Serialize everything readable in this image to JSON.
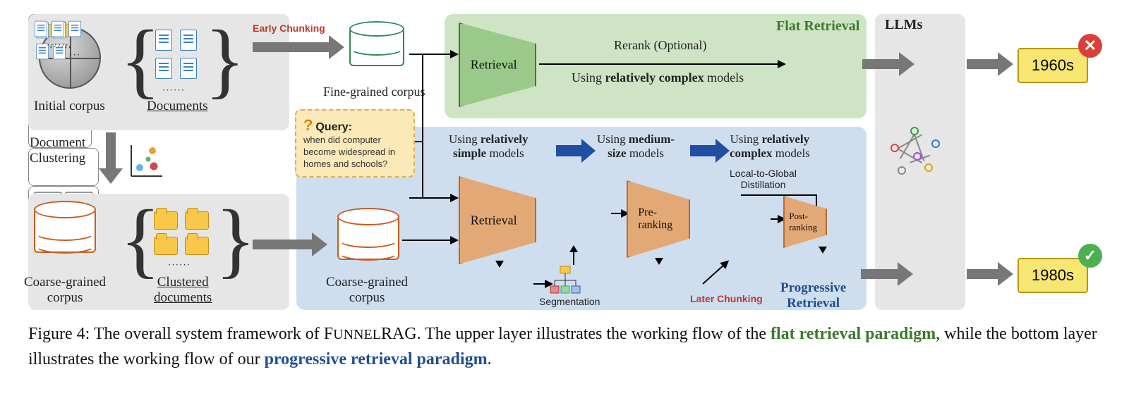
{
  "labels": {
    "initial_corpus": "Initial corpus",
    "documents": "Documents",
    "document_clustering": "Document\nClustering",
    "coarse_corpus_left": "Coarse-grained\ncorpus",
    "clustered_documents": "Clustered\ndocuments",
    "early_chunking": "Early Chunking",
    "fine_corpus": "Fine-grained corpus",
    "coarse_corpus_right": "Coarse-grained\ncorpus",
    "query_label": "Query:",
    "query_text": "when did computer become widespread in homes and schools?",
    "retrieval": "Retrieval",
    "pre_ranking": "Pre-\nranking",
    "post_ranking": "Post-\nranking",
    "rerank": "Rerank (Optional)",
    "using_complex": "Using relatively complex models",
    "using_simple": "Using relatively\nsimple models",
    "using_medium": "Using medium-\nsize models",
    "using_complex2": "Using relatively\ncomplex models",
    "local_to_global": "Local-to-Global\nDistillation",
    "flat_retrieval": "Flat Retrieval",
    "progressive_retrieval": "Progressive\nRetrieval",
    "segmentation": "Segmentation",
    "later_chunking": "Later Chunking",
    "llms": "LLMs",
    "answer_wrong": "1960s",
    "answer_right": "1980s"
  },
  "caption": {
    "prefix": "Figure 4: The overall system framework of ",
    "system": "FunnelRAG",
    "mid1": ". The upper layer illustrates the working flow of the ",
    "flat": "flat retrieval paradigm",
    "mid2": ", while the bottom layer illustrates the working flow of our ",
    "prog": "progressive retrieval paradigm",
    "end": "."
  }
}
